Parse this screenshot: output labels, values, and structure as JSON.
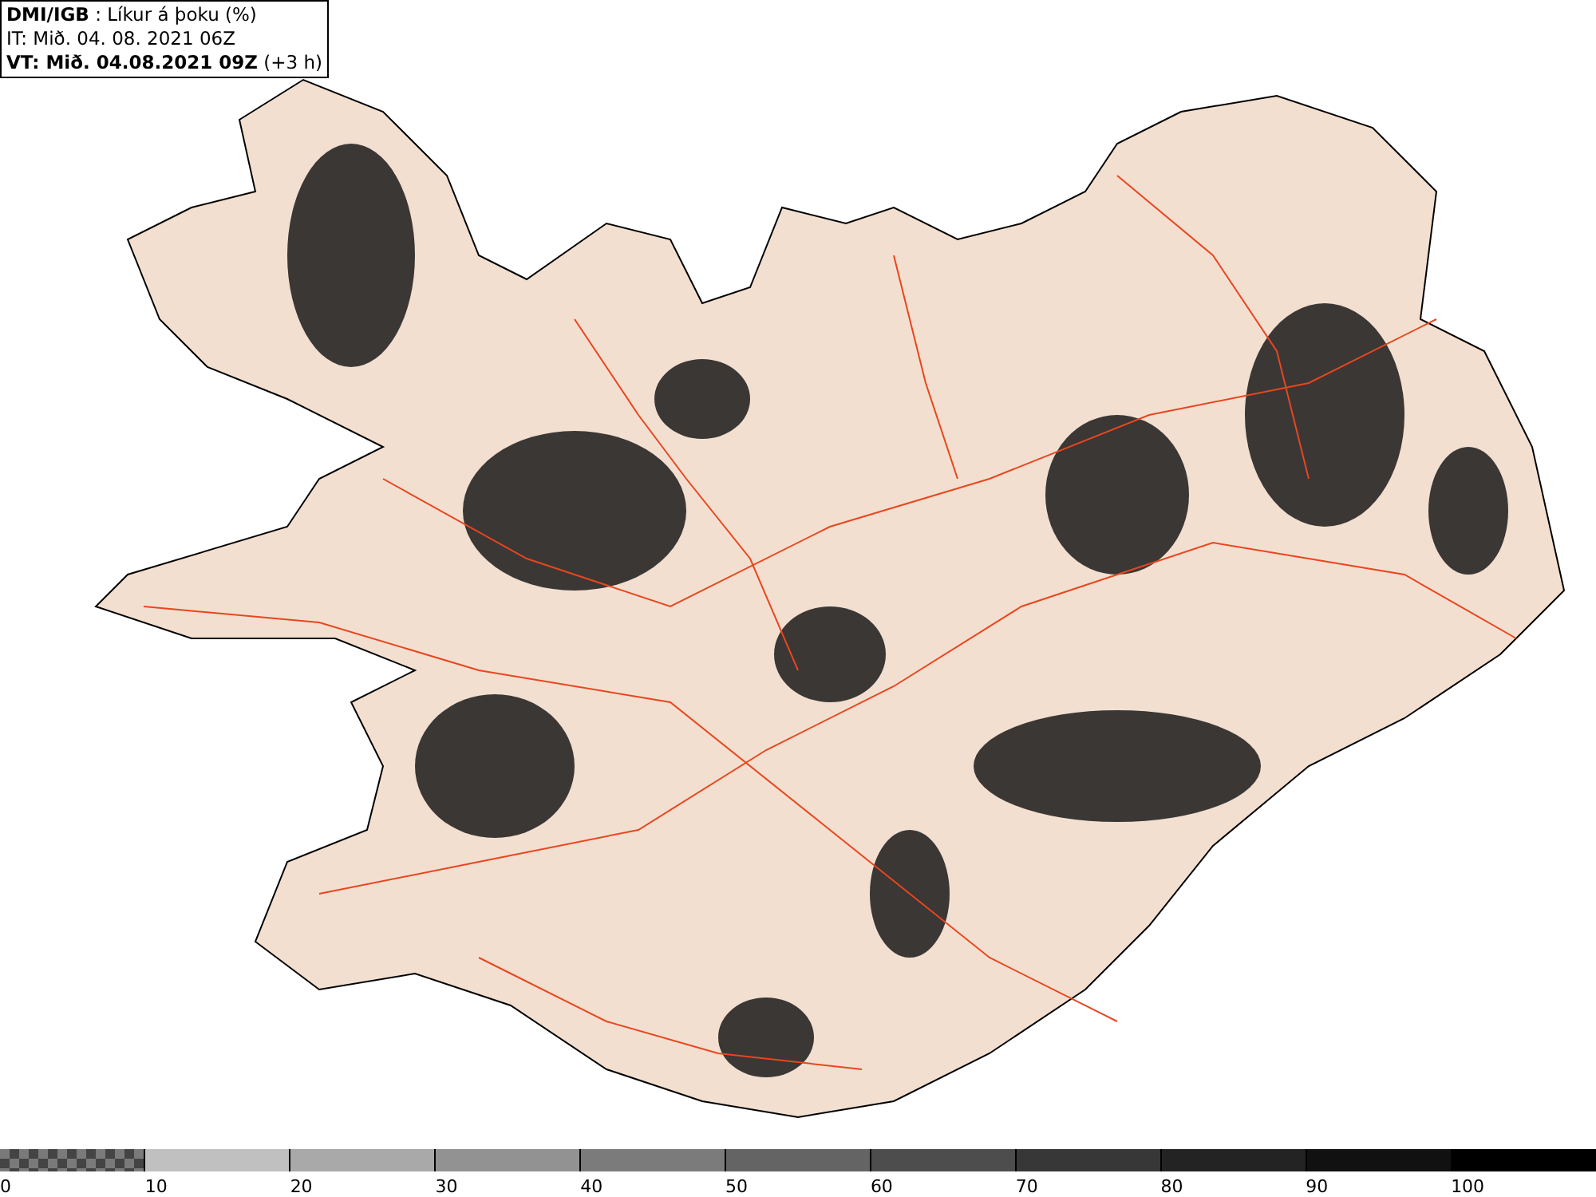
{
  "title_box": {
    "lines": [
      "**DMI/IGB** : Líkur á þoku (%)",
      "IT: Mið. 04. 08. 2021 06Z",
      "**VT: Mið. 04.08.2021 09Z** (+3 h)"
    ]
  },
  "legend": {
    "segments": [
      {
        "kind": "checker",
        "color": "#7a7a7a",
        "label": "0"
      },
      {
        "kind": "solid",
        "color": "#c0c0c0",
        "label": "10"
      },
      {
        "kind": "solid",
        "color": "#a9a9a9",
        "label": "20"
      },
      {
        "kind": "solid",
        "color": "#929292",
        "label": "30"
      },
      {
        "kind": "solid",
        "color": "#7b7b7b",
        "label": "40"
      },
      {
        "kind": "solid",
        "color": "#646464",
        "label": "50"
      },
      {
        "kind": "solid",
        "color": "#4d4d4d",
        "label": "60"
      },
      {
        "kind": "solid",
        "color": "#373737",
        "label": "70"
      },
      {
        "kind": "solid",
        "color": "#232323",
        "label": "80"
      },
      {
        "kind": "solid",
        "color": "#111111",
        "label": "90"
      },
      {
        "kind": "solid",
        "color": "#000000",
        "label": "100"
      }
    ]
  }
}
